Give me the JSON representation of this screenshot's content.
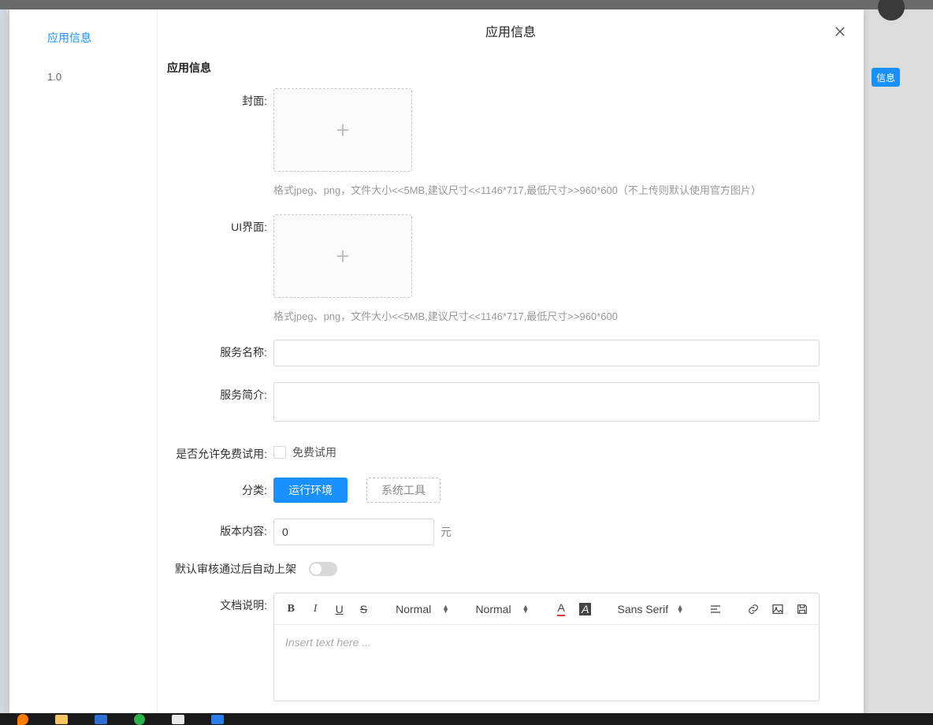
{
  "bg": {
    "right_btn": "信息"
  },
  "sidebar": {
    "items": [
      {
        "label": "应用信息"
      },
      {
        "label": "1.0"
      }
    ]
  },
  "modal": {
    "title": "应用信息",
    "section_title": "应用信息"
  },
  "form": {
    "cover": {
      "label": "封面:",
      "hint": "格式jpeg、png，文件大小<<5MB,建议尺寸<<1146*717,最低尺寸>>960*600（不上传则默认使用官方图片）"
    },
    "ui": {
      "label": "UI界面:",
      "hint": "格式jpeg、png，文件大小<<5MB,建议尺寸<<1146*717,最低尺寸>>960*600"
    },
    "service_name": {
      "label": "服务名称:",
      "value": ""
    },
    "service_desc": {
      "label": "服务简介:",
      "value": ""
    },
    "free_trial": {
      "label": "是否允许免费试用:",
      "checkbox_label": "免费试用"
    },
    "category": {
      "label": "分类:",
      "option_selected": "运行环境",
      "option_other": "系统工具"
    },
    "version": {
      "label": "版本内容:",
      "value": "0",
      "unit": "元"
    },
    "auto_publish": {
      "label": "默认审核通过后自动上架"
    },
    "doc": {
      "label": "文档说明:",
      "toolbar": {
        "heading": "Normal",
        "size": "Normal",
        "font": "Sans Serif"
      },
      "placeholder": "Insert text here ..."
    }
  }
}
